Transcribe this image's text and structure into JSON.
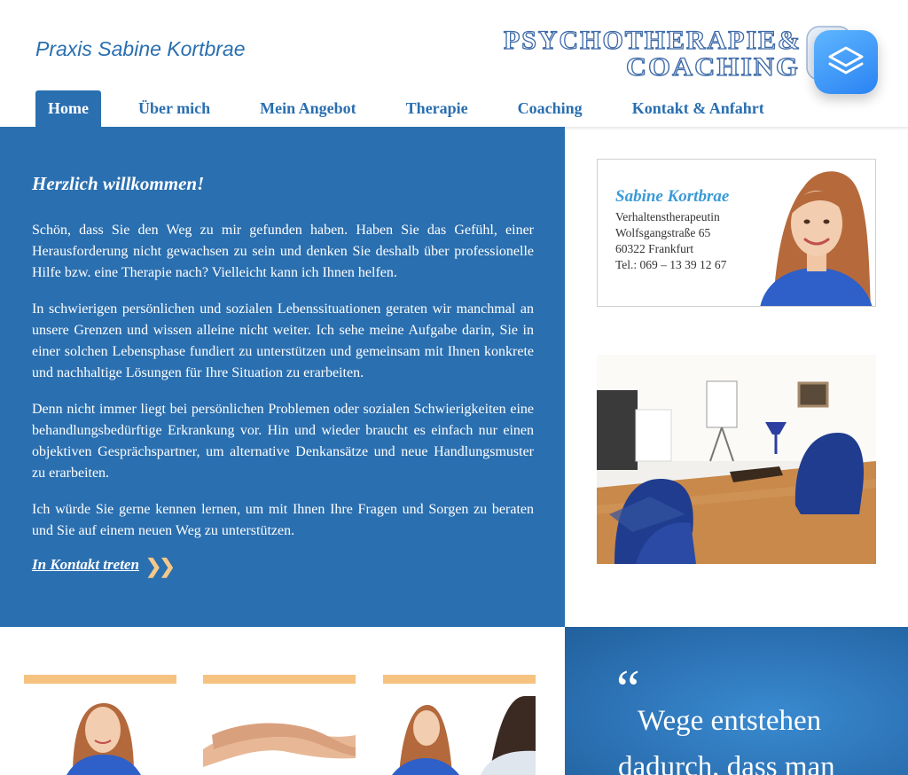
{
  "header": {
    "site_title": "Praxis Sabine Kortbrae",
    "logo_line1": "PSYCHOTHERAPIE&",
    "logo_line2": "COACHING"
  },
  "nav": {
    "items": [
      {
        "label": "Home",
        "active": true
      },
      {
        "label": "Über mich"
      },
      {
        "label": "Mein Angebot"
      },
      {
        "label": "Therapie"
      },
      {
        "label": "Coaching"
      },
      {
        "label": "Kontakt & Anfahrt"
      }
    ]
  },
  "welcome": {
    "heading": "Herzlich willkommen!",
    "paragraphs": [
      "Schön, dass Sie den Weg zu mir gefunden haben. Haben Sie das Gefühl, einer Herausforderung nicht gewachsen zu sein und denken Sie deshalb über professionelle Hilfe bzw. eine Therapie nach? Vielleicht kann ich Ihnen helfen.",
      "In schwierigen persönlichen und sozialen Lebenssituationen geraten wir manchmal an unsere Grenzen und wissen alleine nicht weiter. Ich sehe meine Aufgabe darin, Sie in einer solchen Lebensphase fundiert zu unterstützen und gemeinsam mit Ihnen konkrete und nachhaltige Lösungen für Ihre Situation zu erarbeiten.",
      "Denn nicht immer liegt bei persönlichen Problemen oder sozialen Schwierigkeiten eine behandlungsbedürftige Erkrankung vor. Hin und wieder braucht es einfach nur einen objektiven Gesprächspartner, um alternative Denkansätze und neue Handlungsmuster zu erarbeiten.",
      "Ich würde Sie gerne kennen lernen, um mit Ihnen Ihre Fragen und Sorgen zu beraten und Sie auf einem neuen Weg zu unterstützen."
    ],
    "contact_link": "In Kontakt treten"
  },
  "card": {
    "name": "Sabine Kortbrae",
    "profession": "Verhaltenstherapeutin",
    "street": "Wolfsgangstraße 65",
    "city": "60322 Frankfurt",
    "phone": "Tel.: 069 – 13 39 12 67"
  },
  "quote": {
    "mark": "“",
    "text": "Wege entstehen dadurch, dass man"
  },
  "colors": {
    "primary_blue": "#2a6fb0",
    "accent_orange": "#f6c27f",
    "card_name_blue": "#3a9ad6"
  }
}
